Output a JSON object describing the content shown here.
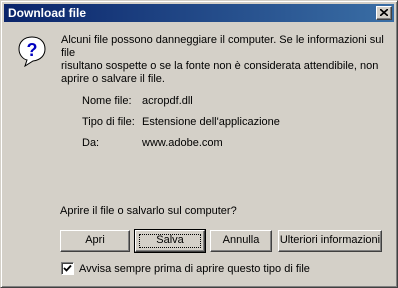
{
  "window": {
    "title": "Download file",
    "close_icon": "close-icon"
  },
  "message": "Alcuni file possono danneggiare il computer. Se le informazioni sul file\nrisultano sospette o se la fonte non è considerata attendibile, non\naprire o salvare il file.",
  "icon": "question-icon",
  "file_info": {
    "name_label": "Nome file:",
    "name_value": "acropdf.dll",
    "type_label": "Tipo di file:",
    "type_value": "Estensione dell'applicazione",
    "from_label": "Da:",
    "from_value": "www.adobe.com"
  },
  "question": "Aprire il file o salvarlo sul computer?",
  "buttons": {
    "open": "Apri",
    "save": "Salva",
    "cancel": "Annulla",
    "more_info": "Ulteriori informazioni"
  },
  "checkbox": {
    "label": "Avvisa sempre prima di aprire questo tipo di file",
    "checked": true
  }
}
